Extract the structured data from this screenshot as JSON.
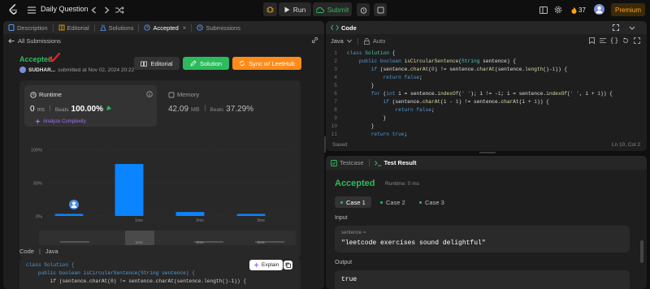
{
  "topbar": {
    "title": "Daily Question",
    "run_label": "Run",
    "submit_label": "Submit",
    "streak": "37",
    "premium_label": "Premium"
  },
  "left_tabs": {
    "description": "Description",
    "editorial": "Editorial",
    "solutions": "Solutions",
    "accepted": "Accepted",
    "submissions": "Submissions"
  },
  "submission": {
    "back_label": "All Submissions",
    "status": "Accepted",
    "user": "SUDHAR...",
    "submitted": "submitted at Nov 02, 2024 20:22",
    "editorial_btn": "Editorial",
    "solution_btn": "Solution",
    "sync_btn": "Sync w/ LeetHub"
  },
  "runtime": {
    "label": "Runtime",
    "value": "0",
    "unit": "ms",
    "beats_label": "Beats",
    "beats": "100.00%",
    "analyze": "Analyze Complexity"
  },
  "memory": {
    "label": "Memory",
    "value": "42.09",
    "unit": "MB",
    "beats_label": "Beats",
    "beats": "37.29%"
  },
  "chart_data": {
    "type": "bar",
    "y_ticks": [
      "100%",
      "50%",
      "0%"
    ],
    "x_ticks": [
      "1ms",
      "2ms",
      "3ms"
    ],
    "slider_ticks": [
      "1ms",
      "2ms",
      "3ms"
    ],
    "values": [
      3,
      78,
      6,
      3
    ],
    "ylim": [
      0,
      100
    ],
    "accent": "#0a84ff"
  },
  "code_preview": {
    "header": "Code",
    "language": "Java",
    "explain_label": "Explain",
    "lines": [
      "class Solution {",
      "    public boolean isCircularSentence(String sentence) {",
      "        if (sentence.charAt(0) != sentence.charAt(sentence.length()-1)) {"
    ]
  },
  "editor": {
    "title": "Code",
    "language": "Java",
    "mode": "Auto",
    "saved": "Saved",
    "cursor": "Ln 10, Col 2",
    "line_numbers": [
      "1",
      "2",
      "3",
      "4",
      "5",
      "6",
      "7",
      "8",
      "9",
      "10",
      "11"
    ]
  },
  "console": {
    "testcase_tab": "Testcase",
    "result_tab": "Test Result",
    "status": "Accepted",
    "runtime": "Runtime: 0 ms",
    "cases": [
      "Case 1",
      "Case 2",
      "Case 3"
    ],
    "input_label": "Input",
    "var_name": "sentence =",
    "var_value": "\"leetcode exercises sound delightful\"",
    "output_label": "Output",
    "output_value": "true"
  },
  "colors": {
    "accepted": "#2cbb5d",
    "blue": "#0a84ff",
    "orange": "#ffa116"
  }
}
